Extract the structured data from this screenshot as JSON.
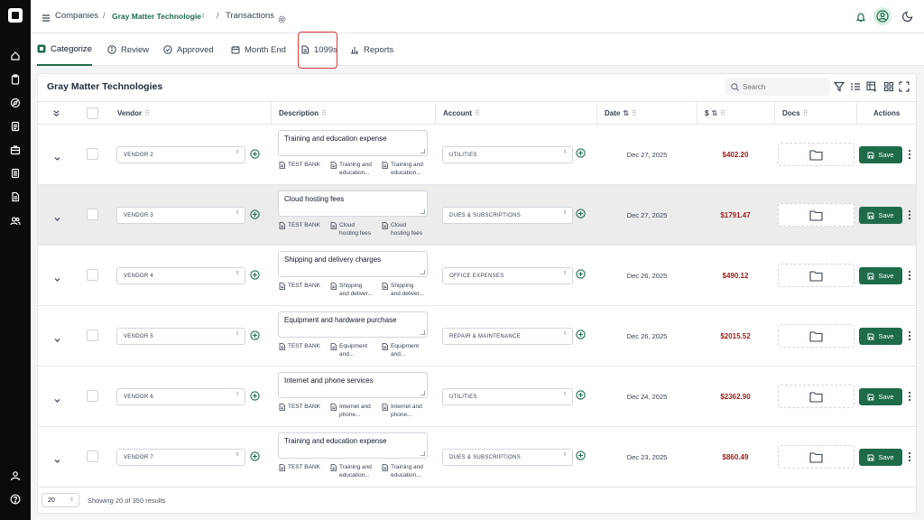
{
  "sidebar": {
    "icons": [
      "home-icon",
      "clipboard-icon",
      "compass-icon",
      "document-icon",
      "briefcase-icon",
      "file-text-icon",
      "file-icon",
      "users-icon",
      "user-icon",
      "help-icon"
    ]
  },
  "breadcrumb": {
    "companies": "Companies",
    "sep1": "/",
    "company": "Gray Matter Technologie",
    "sep2": "/",
    "page": "Transactions"
  },
  "tabs": [
    {
      "label": "Categorize",
      "icon": "logo-icon",
      "active": true
    },
    {
      "label": "Review",
      "icon": "info-circle-icon"
    },
    {
      "label": "Approved",
      "icon": "check-circle-icon"
    },
    {
      "label": "Month End",
      "icon": "calendar-icon"
    },
    {
      "label": "1099s",
      "icon": "file-icon"
    },
    {
      "label": "Reports",
      "icon": "bar-chart-icon"
    }
  ],
  "card": {
    "title": "Gray Matter Technologies",
    "search_placeholder": "Search"
  },
  "columns": {
    "vendor": "Vendor",
    "description": "Description",
    "account": "Account",
    "date": "Date",
    "amount": "$",
    "docs": "Docs",
    "actions": "Actions",
    "sort_icon": "⇅"
  },
  "rows": [
    {
      "vendor": "VENDOR 2",
      "description": "Training and education expense",
      "bank": "TEST BANK",
      "att1": "Training and",
      "att1b": "education...",
      "att2": "Training and",
      "att2b": "education...",
      "account": "UTILITIES",
      "date": "Dec 27, 2025",
      "amount": "$402.20",
      "save": "Save"
    },
    {
      "vendor": "VENDOR 3",
      "description": "Cloud hosting fees",
      "bank": "TEST BANK",
      "att1": "Cloud",
      "att1b": "hosting fees",
      "att2": "Cloud",
      "att2b": "hosting fees",
      "account": "DUES & SUBSCRIPTIONS",
      "date": "Dec 27, 2025",
      "amount": "$1791.47",
      "save": "Save"
    },
    {
      "vendor": "VENDOR 4",
      "description": "Shipping and delivery charges",
      "bank": "TEST BANK",
      "att1": "Shipping",
      "att1b": "and deliver...",
      "att2": "Shipping",
      "att2b": "and deliver...",
      "account": "OFFICE EXPENSES",
      "date": "Dec 26, 2025",
      "amount": "$490.12",
      "save": "Save"
    },
    {
      "vendor": "VENDOR 5",
      "description": "Equipment and hardware purchase",
      "bank": "TEST BANK",
      "att1": "Equipment",
      "att1b": "and...",
      "att2": "Equipment",
      "att2b": "and...",
      "account": "REPAIR & MAINTENANCE",
      "date": "Dec 26, 2025",
      "amount": "$2015.52",
      "save": "Save"
    },
    {
      "vendor": "VENDOR 6",
      "description": "Internet and phone services",
      "bank": "TEST BANK",
      "att1": "Internet and",
      "att1b": "phone...",
      "att2": "Internet and",
      "att2b": "phone...",
      "account": "UTILITIES",
      "date": "Dec 24, 2025",
      "amount": "$2362.90",
      "save": "Save"
    },
    {
      "vendor": "VENDOR 7",
      "description": "Training and education expense",
      "bank": "TEST BANK",
      "att1": "Training and",
      "att1b": "education...",
      "att2": "Training and",
      "att2b": "education...",
      "account": "DUES & SUBSCRIPTIONS",
      "date": "Dec 23, 2025",
      "amount": "$860.49",
      "save": "Save"
    }
  ],
  "footer": {
    "per_page": "20",
    "showing": "Showing 20 of 350 results"
  },
  "colors": {
    "brand": "#1e6b4a",
    "amount": "#9b1c1c",
    "highlight": "#d93838"
  }
}
